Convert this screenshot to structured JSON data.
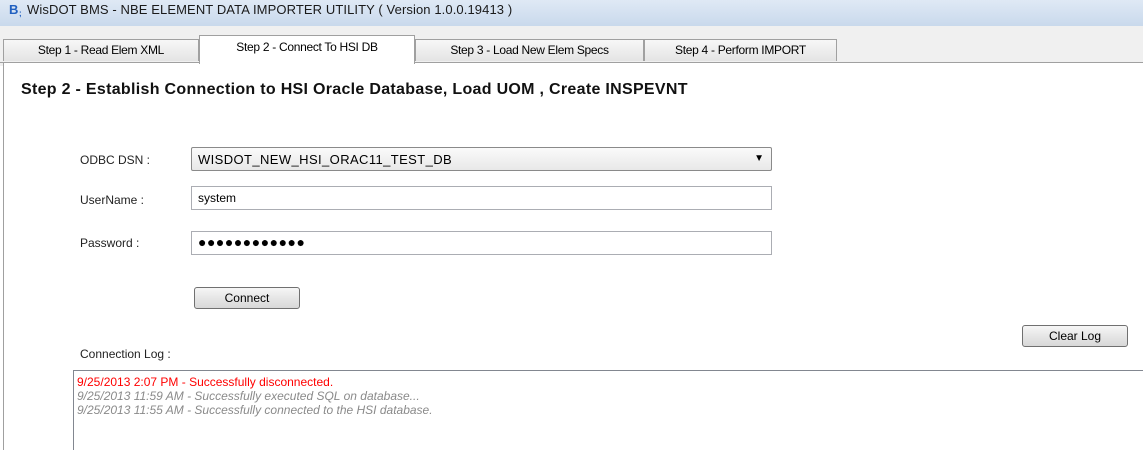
{
  "window": {
    "title": "WisDOT BMS - NBE ELEMENT DATA IMPORTER UTILITY ( Version 1.0.0.19413 )",
    "icon": "app-icon"
  },
  "tabs": [
    {
      "label": "Step 1 - Read Elem XML"
    },
    {
      "label": "Step 2 - Connect To HSI DB",
      "active": true
    },
    {
      "label": "Step 3 - Load New Elem Specs"
    },
    {
      "label": "Step 4 - Perform IMPORT"
    }
  ],
  "step2": {
    "heading": "Step 2 - Establish Connection to HSI Oracle Database, Load UOM , Create INSPEVNT",
    "dsn": {
      "label": "ODBC DSN :",
      "value": "WISDOT_NEW_HSI_ORAC11_TEST_DB"
    },
    "username": {
      "label": "UserName :",
      "value": "system"
    },
    "password": {
      "label": "Password :",
      "value": "●●●●●●●●●●●●"
    },
    "connect_label": "Connect",
    "clear_log_label": "Clear Log",
    "log_label": "Connection Log :",
    "log": [
      {
        "text": "9/25/2013 2:07 PM - Successfully disconnected.",
        "kind": "error"
      },
      {
        "text": "9/25/2013 11:59 AM - Successfully executed SQL on database...",
        "kind": "info"
      },
      {
        "text": "9/25/2013 11:55 AM - Successfully connected to the HSI database.",
        "kind": "info"
      }
    ]
  },
  "colors": {
    "log_error": "#ff0000",
    "log_info": "#8a8a8a"
  }
}
